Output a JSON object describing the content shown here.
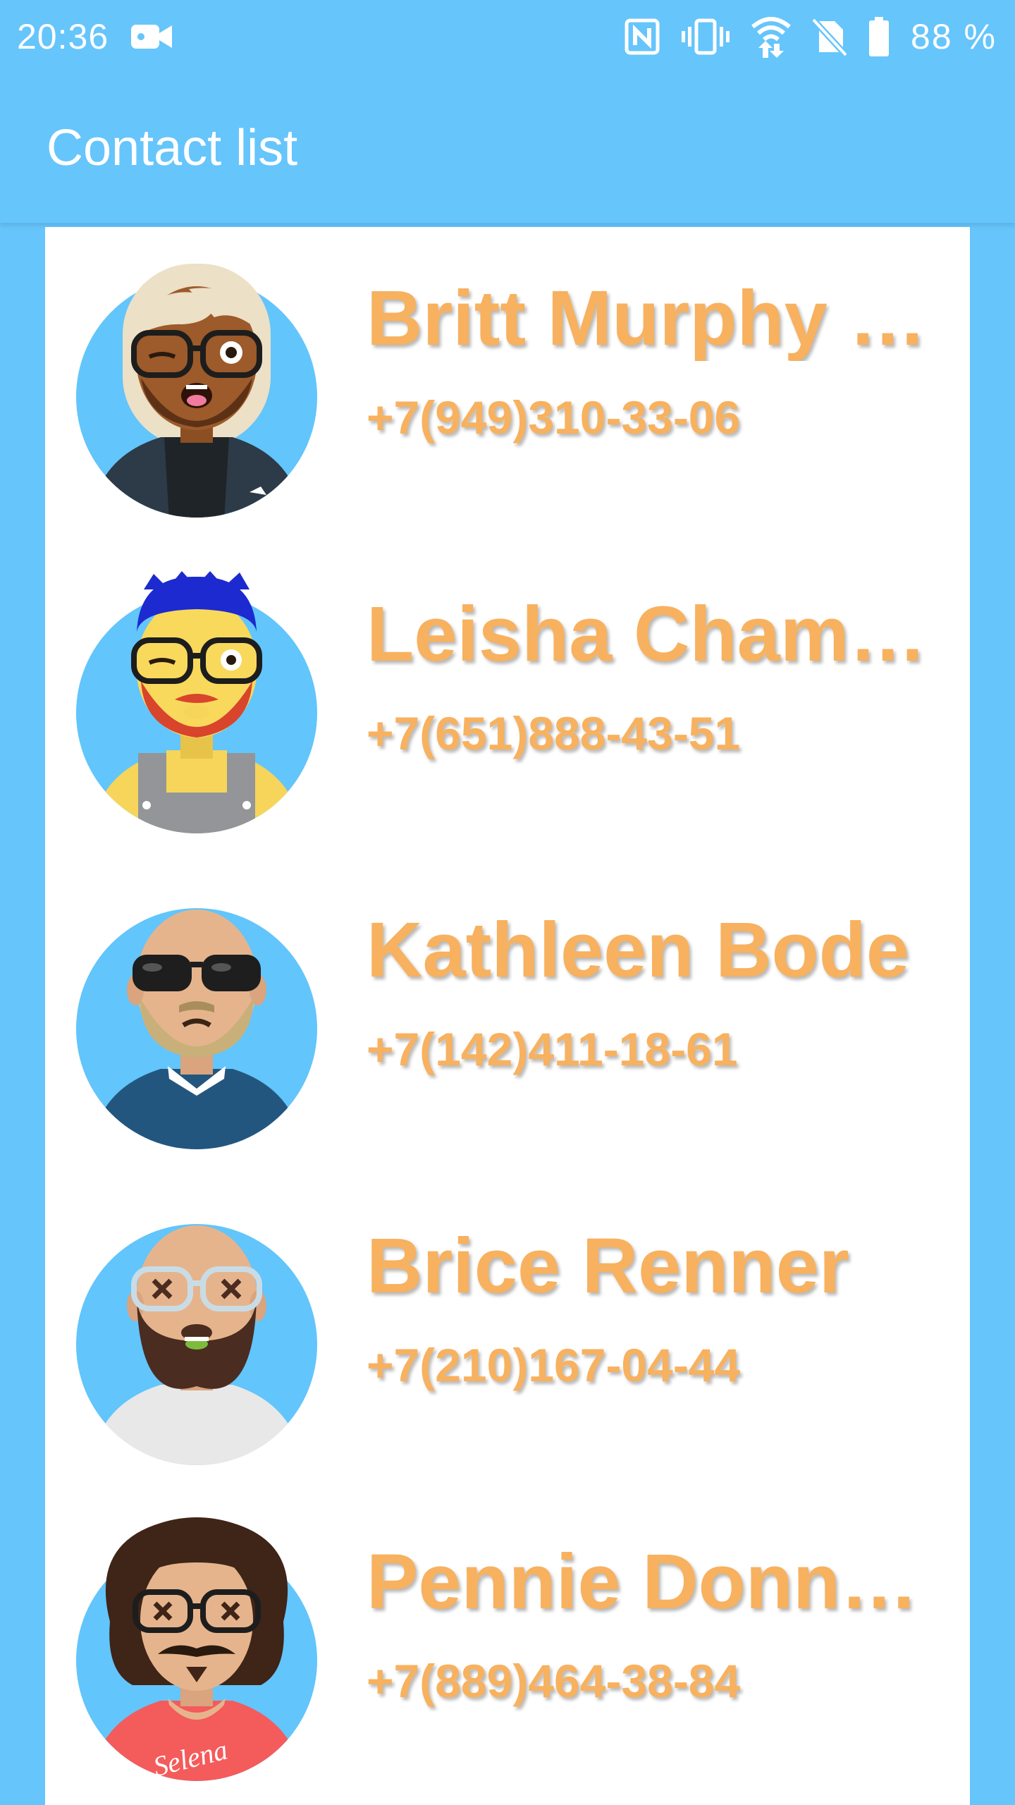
{
  "status_bar": {
    "time": "20:36",
    "battery": "88 %",
    "icons": [
      "video-camera-icon",
      "nfc-icon",
      "vibrate-icon",
      "wifi-icon",
      "no-sim-icon",
      "battery-icon"
    ]
  },
  "app_bar": {
    "title": "Contact list"
  },
  "colors": {
    "background": "#66c5fb",
    "card": "#ffffff",
    "contact_text": "#f7b15f",
    "avatar_circle": "#62c5fb"
  },
  "contacts": [
    {
      "name": "Britt Murphy …",
      "phone": "+7(949)310-33-06",
      "avatar": "avatar-dark-skin-white-hair-winking-glasses"
    },
    {
      "name": "Leisha Cham…",
      "phone": "+7(651)888-43-51",
      "avatar": "avatar-blue-hair-red-beard-glasses"
    },
    {
      "name": "Kathleen Bode",
      "phone": "+7(142)411-18-61",
      "avatar": "avatar-bald-sunglasses-beard"
    },
    {
      "name": "Brice Renner",
      "phone": "+7(210)167-04-44",
      "avatar": "avatar-bald-dark-beard-x-glasses"
    },
    {
      "name": "Pennie Donn…",
      "phone": "+7(889)464-38-84",
      "avatar": "avatar-curly-hair-mustache-x-glasses"
    }
  ],
  "avatars": {
    "shirt_text": "Selena"
  }
}
